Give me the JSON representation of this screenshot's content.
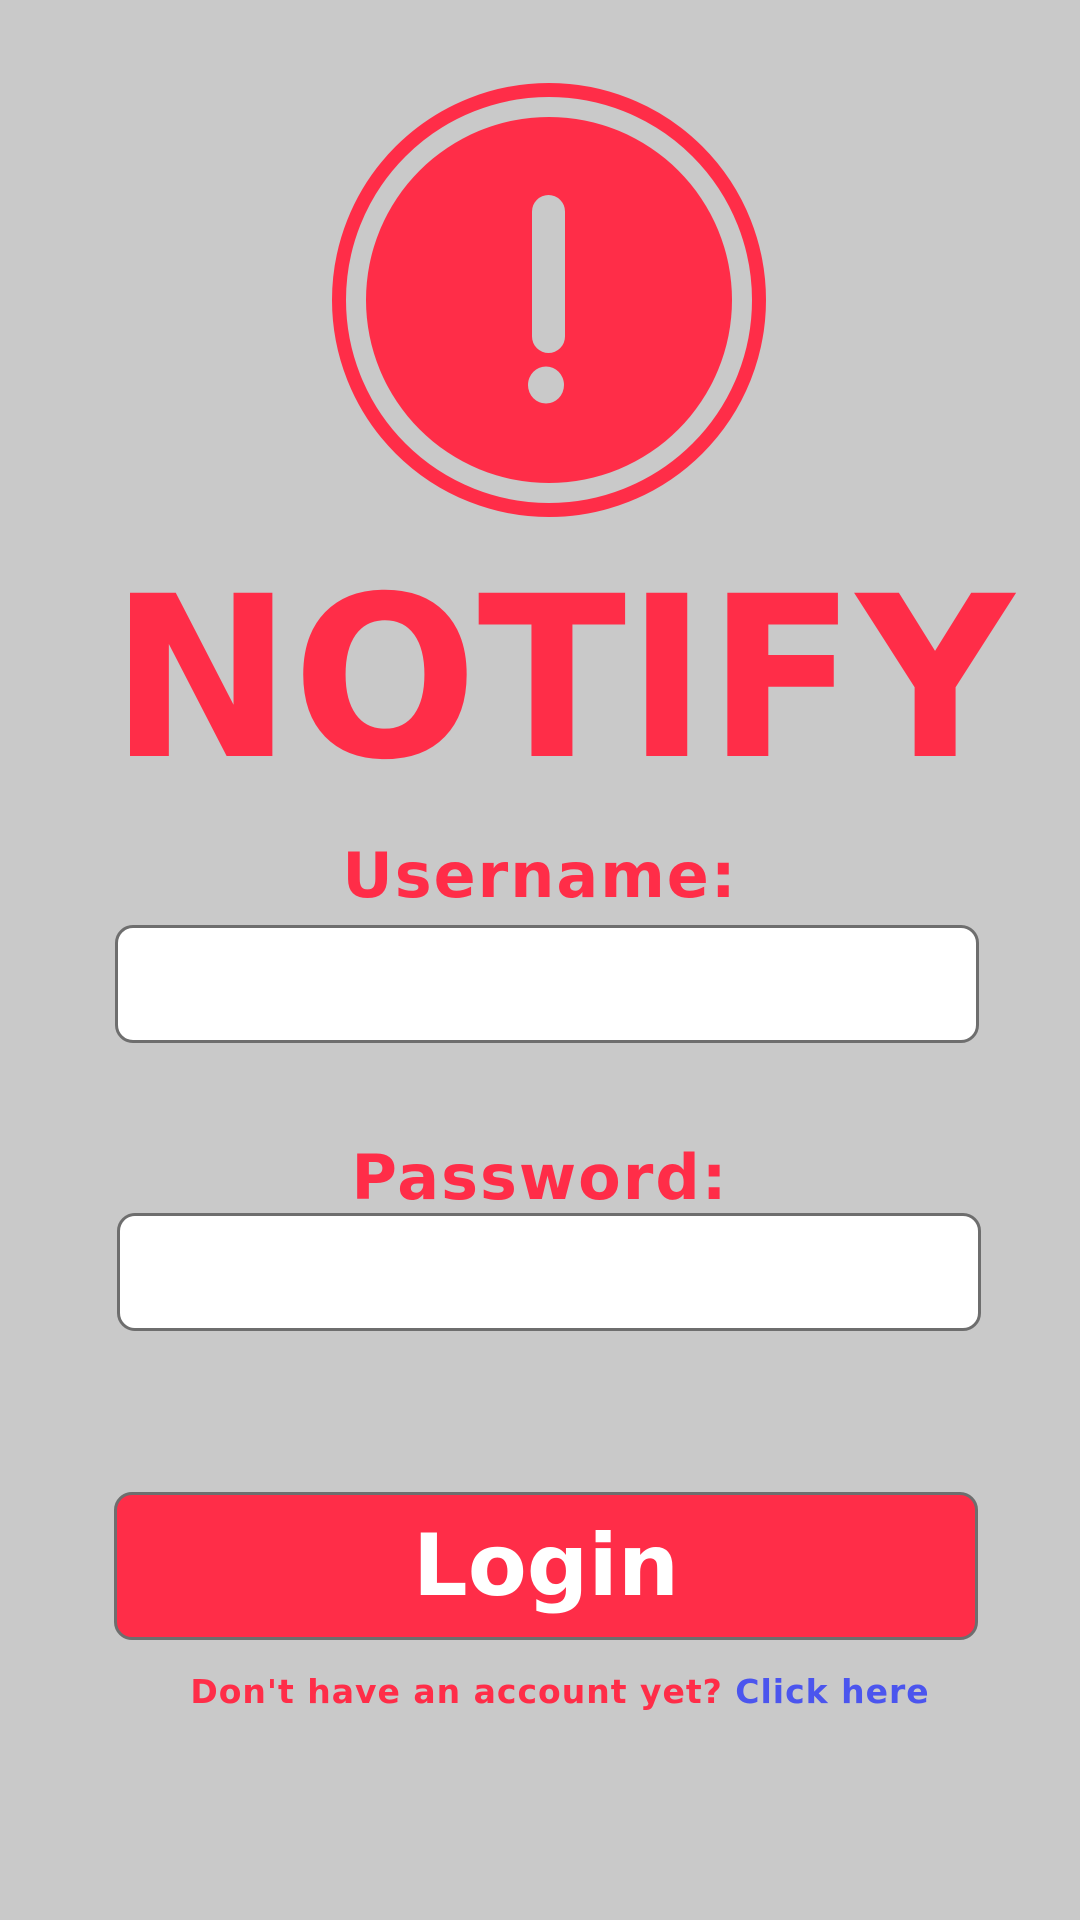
{
  "app": {
    "name": "NOTIFY"
  },
  "brand": {
    "accent_color": "#ff2d48",
    "link_color": "#4b55ee",
    "background_color": "#c9c9c9",
    "logo_icon": "exclamation-circle-icon"
  },
  "login_form": {
    "username_label": "Username:",
    "username_value": "",
    "password_label": "Password:",
    "password_value": "",
    "login_button_label": "Login"
  },
  "signup": {
    "prompt_text": "Don't have an account yet? ",
    "link_text": "Click here"
  }
}
